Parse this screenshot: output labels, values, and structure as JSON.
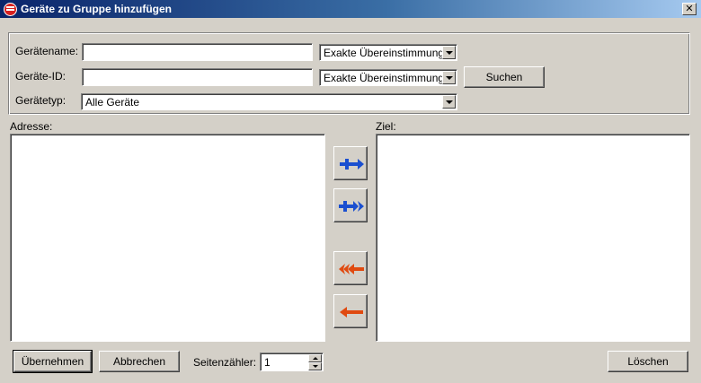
{
  "window": {
    "title": "Geräte zu Gruppe hinzufügen",
    "app_icon": "app-icon",
    "close_glyph": "✕"
  },
  "filters": {
    "name_label": "Gerätename:",
    "name_value": "",
    "name_match": "Exakte Übereinstimmung",
    "id_label": "Geräte-ID:",
    "id_value": "",
    "id_match": "Exakte Übereinstimmung",
    "type_label": "Gerätetyp:",
    "type_value": "Alle Geräte",
    "search_label": "Suchen"
  },
  "lists": {
    "source_label": "Adresse:",
    "target_label": "Ziel:"
  },
  "transfer_buttons": {
    "icons": [
      "arrow-right-icon",
      "double-arrow-right-icon",
      "double-arrow-left-icon",
      "arrow-left-icon"
    ],
    "colors": {
      "forward": "#1a4fd0",
      "back": "#e04a10"
    }
  },
  "footer": {
    "apply_label": "Übernehmen",
    "cancel_label": "Abbrechen",
    "page_counter_label": "Seitenzähler:",
    "page_counter_value": "1",
    "delete_label": "Löschen"
  }
}
